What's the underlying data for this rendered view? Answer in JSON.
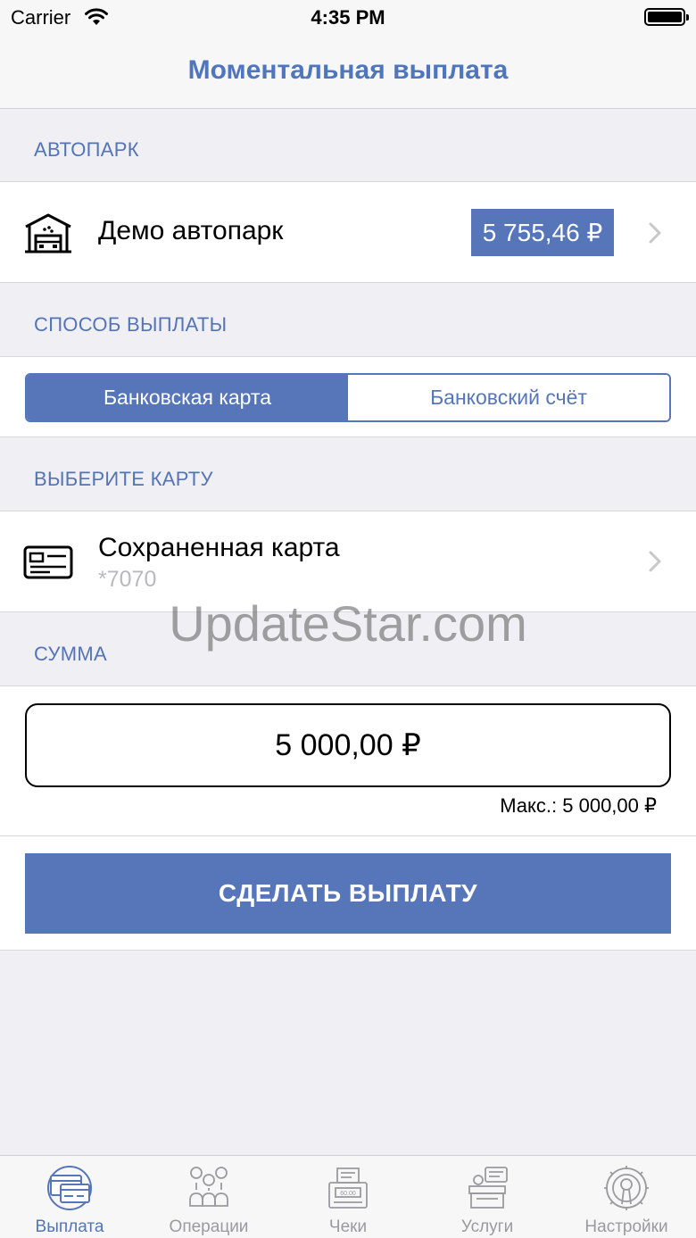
{
  "status_bar": {
    "carrier": "Carrier",
    "time": "4:35 PM"
  },
  "nav": {
    "title": "Моментальная выплата"
  },
  "fleet": {
    "header": "АВТОПАРК",
    "name": "Демо автопарк",
    "balance": "5 755,46 ₽"
  },
  "payout_method": {
    "header": "СПОСОБ ВЫПЛАТЫ",
    "options": [
      "Банковская карта",
      "Банковский счёт"
    ],
    "selected": "Банковская карта"
  },
  "card": {
    "header": "ВЫБЕРИТЕ КАРТУ",
    "title": "Сохраненная карта",
    "number": "*7070"
  },
  "amount": {
    "header": "СУММА",
    "value": "5 000,00 ₽",
    "max": "Макс.: 5 000,00 ₽"
  },
  "submit": {
    "label": "СДЕЛАТЬ ВЫПЛАТУ"
  },
  "watermark": "UpdateStar.com",
  "tabs": [
    {
      "label": "Выплата",
      "icon": "payout-icon",
      "active": true
    },
    {
      "label": "Операции",
      "icon": "operations-icon",
      "active": false
    },
    {
      "label": "Чеки",
      "icon": "receipts-icon",
      "active": false
    },
    {
      "label": "Услуги",
      "icon": "services-icon",
      "active": false
    },
    {
      "label": "Настройки",
      "icon": "settings-icon",
      "active": false
    }
  ],
  "colors": {
    "accent": "#5676b9",
    "title": "#4f76bd",
    "background": "#efeff4",
    "inactive_tab": "#9a9a9f"
  }
}
